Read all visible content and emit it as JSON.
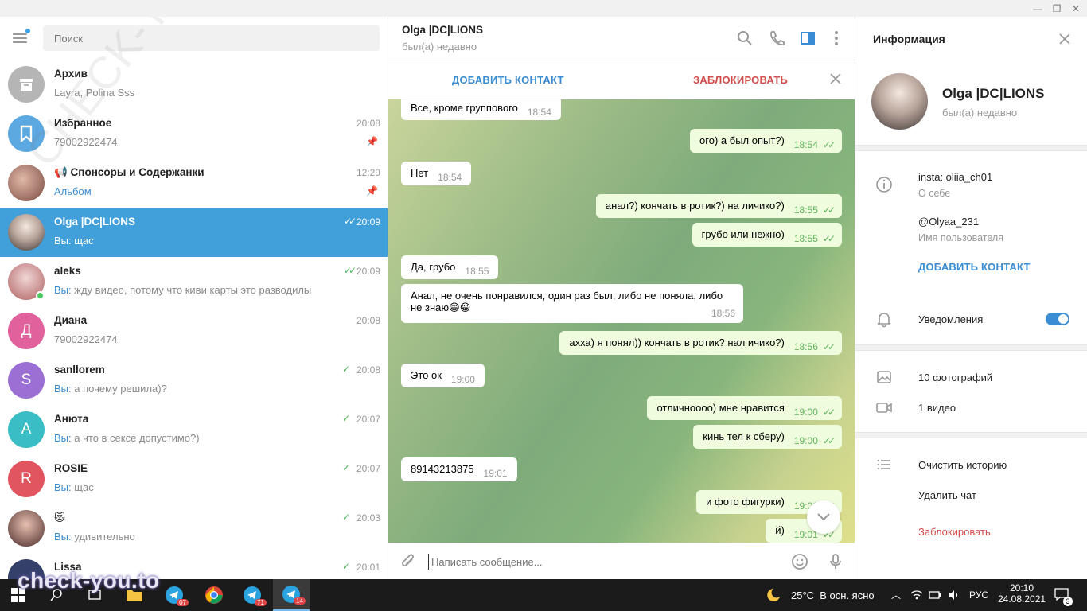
{
  "window": {
    "minimize": "—",
    "restore": "❐",
    "close": "✕"
  },
  "search": {
    "placeholder": "Поиск"
  },
  "chats": [
    {
      "name": "Архив",
      "preview": "Layra, Polina Sss",
      "time": "",
      "avatar_letter": "",
      "avatar_color": "#b5b5b5"
    },
    {
      "name": "Избранное",
      "preview": "79002922474",
      "time": "20:08",
      "avatar_letter": "",
      "avatar_color": "#5ca8e0"
    },
    {
      "name": "📢 Спонсоры и Содержанки",
      "preview": "Альбом",
      "time": "12:29",
      "avatar_letter": "",
      "avatar_color": "#a86a5c"
    },
    {
      "name": "Olga |DC|LIONS",
      "preview": "Вы: щас",
      "time": "20:09",
      "avatar_letter": "",
      "avatar_color": "#8c8c8c"
    },
    {
      "name": "aleks",
      "preview_you": "Вы:",
      "preview": "жду видео, потому что киви карты это разводилы",
      "time": "20:09",
      "avatar_letter": "",
      "avatar_color": "#c9a0a0"
    },
    {
      "name": "Диана",
      "preview": "79002922474",
      "time": "20:08",
      "avatar_letter": "Д",
      "avatar_color": "#e0619b"
    },
    {
      "name": "sanllorem",
      "preview_you": "Вы:",
      "preview": "а почему решила)?",
      "time": "20:08",
      "avatar_letter": "S",
      "avatar_color": "#9b6fd4"
    },
    {
      "name": "Анюта",
      "preview_you": "Вы:",
      "preview": "а что в сексе допустимо?)",
      "time": "20:07",
      "avatar_letter": "А",
      "avatar_color": "#3bbdc6"
    },
    {
      "name": "ROSIE",
      "preview": "щас",
      "preview_you": "Вы:",
      "time": "20:07",
      "avatar_letter": "R",
      "avatar_color": "#e0555f"
    },
    {
      "name": "😻",
      "preview_you": "Вы:",
      "preview": "удивительно",
      "time": "20:03",
      "avatar_letter": "",
      "avatar_color": "#5a3a3a"
    },
    {
      "name": "Lissa",
      "preview": "",
      "time": "20:01",
      "avatar_letter": "",
      "avatar_color": "#34406a"
    }
  ],
  "peer": {
    "name": "Olga |DC|LIONS",
    "status": "был(а) недавно"
  },
  "action_bar": {
    "add_contact": "ДОБАВИТЬ КОНТАКТ",
    "block": "ЗАБЛОКИРОВАТЬ"
  },
  "messages": [
    {
      "dir": "in",
      "text": "Все, кроме группового",
      "time": "18:54"
    },
    {
      "dir": "out",
      "text": "ого) а был опыт?)",
      "time": "18:54"
    },
    {
      "dir": "in",
      "text": "Нет",
      "time": "18:54"
    },
    {
      "dir": "out",
      "text": "анал?) кончать в ротик?) на личико?)",
      "time": "18:55"
    },
    {
      "dir": "out",
      "text": "грубо или нежно)",
      "time": "18:55"
    },
    {
      "dir": "in",
      "text": "Да, грубо",
      "time": "18:55"
    },
    {
      "dir": "in",
      "text": "Анал, не очень понравился, один раз был, либо не поняла, либо не знаю😁😁",
      "time": "18:56"
    },
    {
      "dir": "out",
      "text": "ахха) я понял)) кончать в ротик? нал ичико?)",
      "time": "18:56"
    },
    {
      "dir": "in",
      "text": "Это ок",
      "time": "19:00"
    },
    {
      "dir": "out",
      "text": "отличнoooo) мне нравится",
      "time": "19:00"
    },
    {
      "dir": "out",
      "text": "кинь тел к сберу)",
      "time": "19:00"
    },
    {
      "dir": "in",
      "text": "89143213875",
      "time": "19:01"
    },
    {
      "dir": "out",
      "text": "и фото фигурки)",
      "time": "19:01"
    },
    {
      "dir": "out",
      "text": "й)",
      "time": "19:01"
    }
  ],
  "composer": {
    "placeholder": "Написать сообщение..."
  },
  "info": {
    "title": "Информация",
    "name": "Olga |DC|LIONS",
    "status": "был(а) недавно",
    "bio": "insta: oliia_ch01",
    "bio_label": "О себе",
    "username": "@Olyaa_231",
    "username_label": "Имя пользователя",
    "add_contact": "ДОБАВИТЬ КОНТАКТ",
    "notifications": "Уведомления",
    "notifications_on": true,
    "photos": "10 фотографий",
    "videos": "1 видео",
    "clear_history": "Очистить историю",
    "delete_chat": "Удалить чат",
    "block": "Заблокировать"
  },
  "taskbar": {
    "badges": [
      "07",
      "71",
      "14"
    ],
    "weather": "25°C  В осн. ясно",
    "lang": "РУС",
    "time": "20:10",
    "date": "24.08.2021",
    "notif_count": "3"
  },
  "watermark": "check-you.to",
  "watermark_bg": "CHECK-YOU.ME"
}
